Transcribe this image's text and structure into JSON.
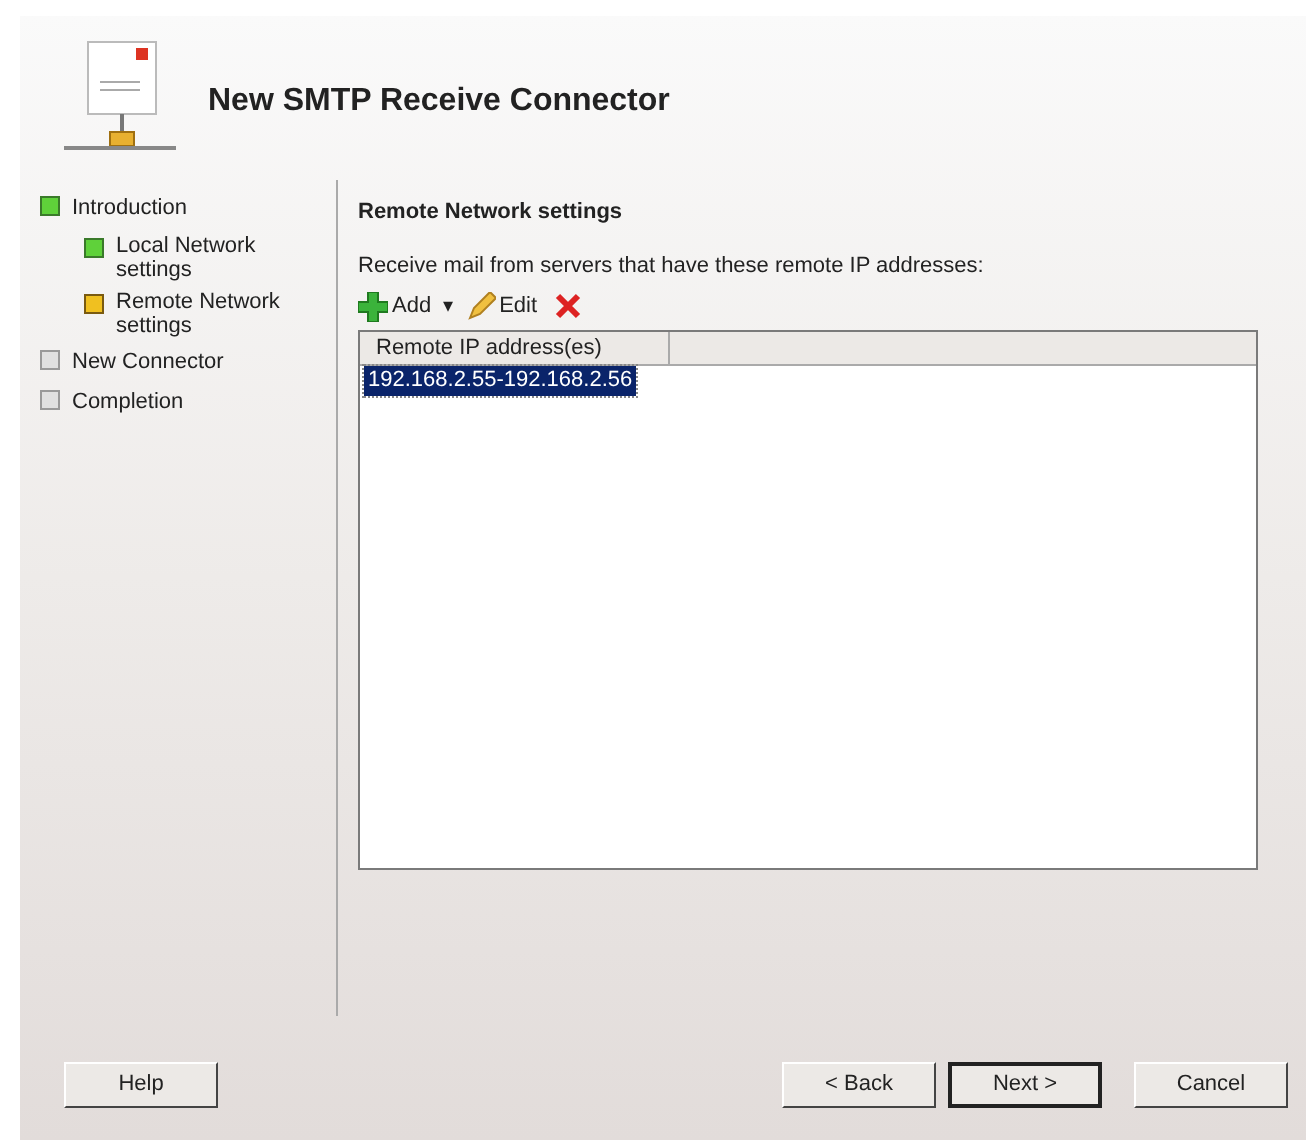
{
  "window": {
    "title": "New SMTP Receive Connector"
  },
  "steps": [
    {
      "label": "Introduction",
      "kind": "done",
      "children": [
        {
          "label": "Local Network settings",
          "kind": "done"
        },
        {
          "label": "Remote Network settings",
          "kind": "current"
        }
      ]
    },
    {
      "label": "New Connector",
      "kind": "pending"
    },
    {
      "label": "Completion",
      "kind": "pending"
    }
  ],
  "page": {
    "heading": "Remote Network settings",
    "description": "Receive mail from servers that have these remote IP addresses:",
    "toolbar": {
      "add": "Add",
      "add_caret": "▾",
      "edit": "Edit"
    },
    "list": {
      "columns": [
        "Remote IP address(es)"
      ],
      "rows": [
        {
          "cells": [
            "192.168.2.55-192.168.2.56"
          ],
          "selected": true
        }
      ]
    }
  },
  "buttons": [
    {
      "label": "Help",
      "kind": "help",
      "default": false
    },
    {
      "label": "< Back",
      "kind": "nav",
      "default": false
    },
    {
      "label": "Next >",
      "kind": "nav",
      "default": true
    },
    {
      "label": "Cancel",
      "kind": "nav",
      "default": false
    }
  ]
}
